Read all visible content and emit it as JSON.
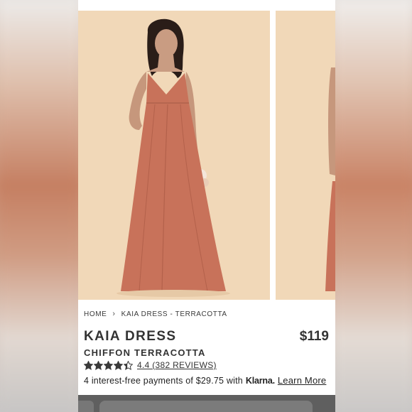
{
  "breadcrumb": {
    "home": "HOME",
    "separator": ">",
    "current": "KAIA DRESS - TERRACOTTA"
  },
  "product": {
    "title": "KAIA DRESS",
    "subtitle": "CHIFFON TERRACOTTA",
    "price": "$119",
    "rating": 4.4,
    "rating_max": 5,
    "rating_text": "4.4 (382 REVIEWS)"
  },
  "klarna": {
    "text_prefix": "4 interest-free payments of $29.75 with",
    "logo": "Klarna.",
    "learn_more": "Learn More"
  },
  "colors": {
    "dress": "#c8725a",
    "background": "#f1d8b8",
    "text": "#333333",
    "star": "#3a3a3a"
  },
  "icons": {
    "star": "star-icon",
    "chevron": "chevron-right-icon"
  }
}
